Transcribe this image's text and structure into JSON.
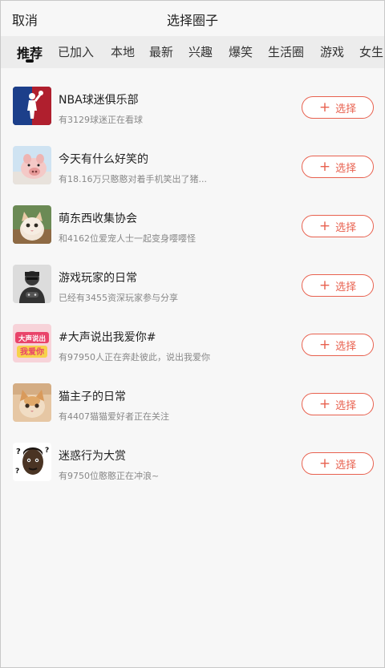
{
  "header": {
    "cancel_label": "取消",
    "title": "选择圈子"
  },
  "tabs": [
    {
      "label": "推荐"
    },
    {
      "label": "已加入"
    },
    {
      "label": "本地"
    },
    {
      "label": "最新"
    },
    {
      "label": "兴趣"
    },
    {
      "label": "爆笑"
    },
    {
      "label": "生活圈"
    },
    {
      "label": "游戏"
    },
    {
      "label": "女生"
    }
  ],
  "active_tab": "推荐",
  "accent_color": "#e8614f",
  "circles": [
    {
      "name": "NBA球迷俱乐部",
      "desc": "有3129球迷正在看球",
      "icon": "nba-logo-icon",
      "button": "选择"
    },
    {
      "name": "今天有什么好笑的",
      "desc": "有18.16万只憨憨对着手机笑出了猪...",
      "icon": "pig-photo-icon",
      "button": "选择"
    },
    {
      "name": "萌东西收集协会",
      "desc": "和4162位爱宠人士一起变身嘤嘤怪",
      "icon": "cat-photo-icon",
      "button": "选择"
    },
    {
      "name": "游戏玩家的日常",
      "desc": "已经有3455资深玩家参与分享",
      "icon": "gamer-icon",
      "button": "选择"
    },
    {
      "name": "#大声说出我爱你#",
      "desc": "有97950人正在奔赴彼此，说出我爱你",
      "icon": "love-sticker-icon",
      "button": "选择"
    },
    {
      "name": "猫主子的日常",
      "desc": "有4407猫猫爱好者正在关注",
      "icon": "kitten-photo-icon",
      "button": "选择"
    },
    {
      "name": "迷惑行为大赏",
      "desc": "有9750位憨憨正在冲浪~",
      "icon": "confused-man-icon",
      "button": "选择"
    }
  ],
  "sticker_text": {
    "line1": "大声说出",
    "line2": "我爱你"
  }
}
